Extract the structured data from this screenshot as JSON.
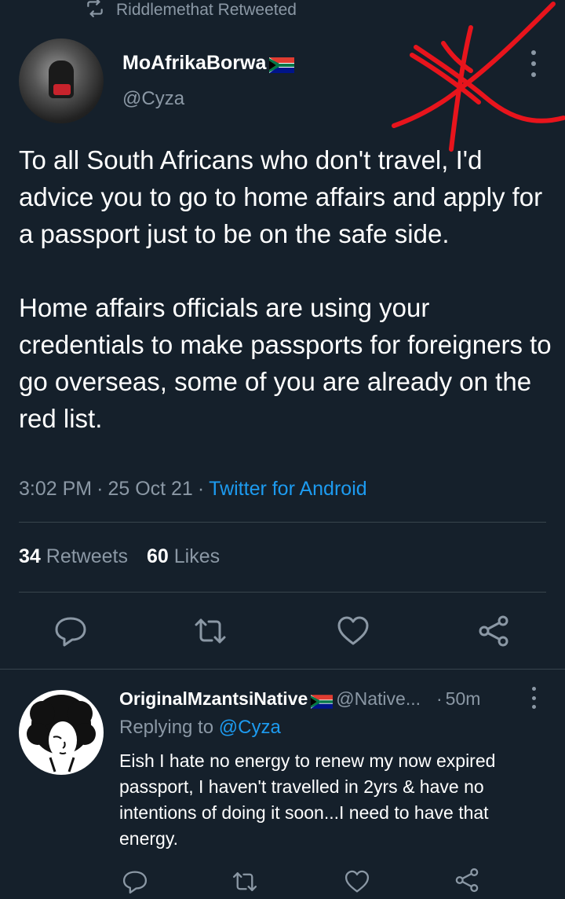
{
  "retweet": {
    "icon": "retweet-icon",
    "text": "Riddlemethat Retweeted"
  },
  "tweet": {
    "author_name": "MoAfrikaBorwa",
    "author_handle": "@Cyza",
    "text": "To all South Africans who don't travel, I'd advice you to go to home affairs and apply for a passport just to be on the safe side.\n\nHome affairs officials are using your credentials to make passports for foreigners to go overseas, some of you are already on the red list.",
    "time": "3:02 PM",
    "date": "25 Oct 21",
    "source": "Twitter for Android",
    "retweets_count": "34",
    "retweets_label": "Retweets",
    "likes_count": "60",
    "likes_label": "Likes"
  },
  "actions": [
    "reply-icon",
    "retweet-icon",
    "like-icon",
    "share-icon"
  ],
  "reply": {
    "author_name": "OriginalMzantsiNative",
    "author_handle": "@Native...",
    "time": "50m",
    "replying_label": "Replying to",
    "replying_handle": "@Cyza",
    "text": "Eish I hate no energy to renew my now expired passport, I haven't travelled in 2yrs & have no intentions of doing it soon...I need to have that energy."
  },
  "colors": {
    "background": "#15202b",
    "muted": "#8b98a5",
    "link": "#1d9bf0",
    "annotation": "#e8141c"
  }
}
